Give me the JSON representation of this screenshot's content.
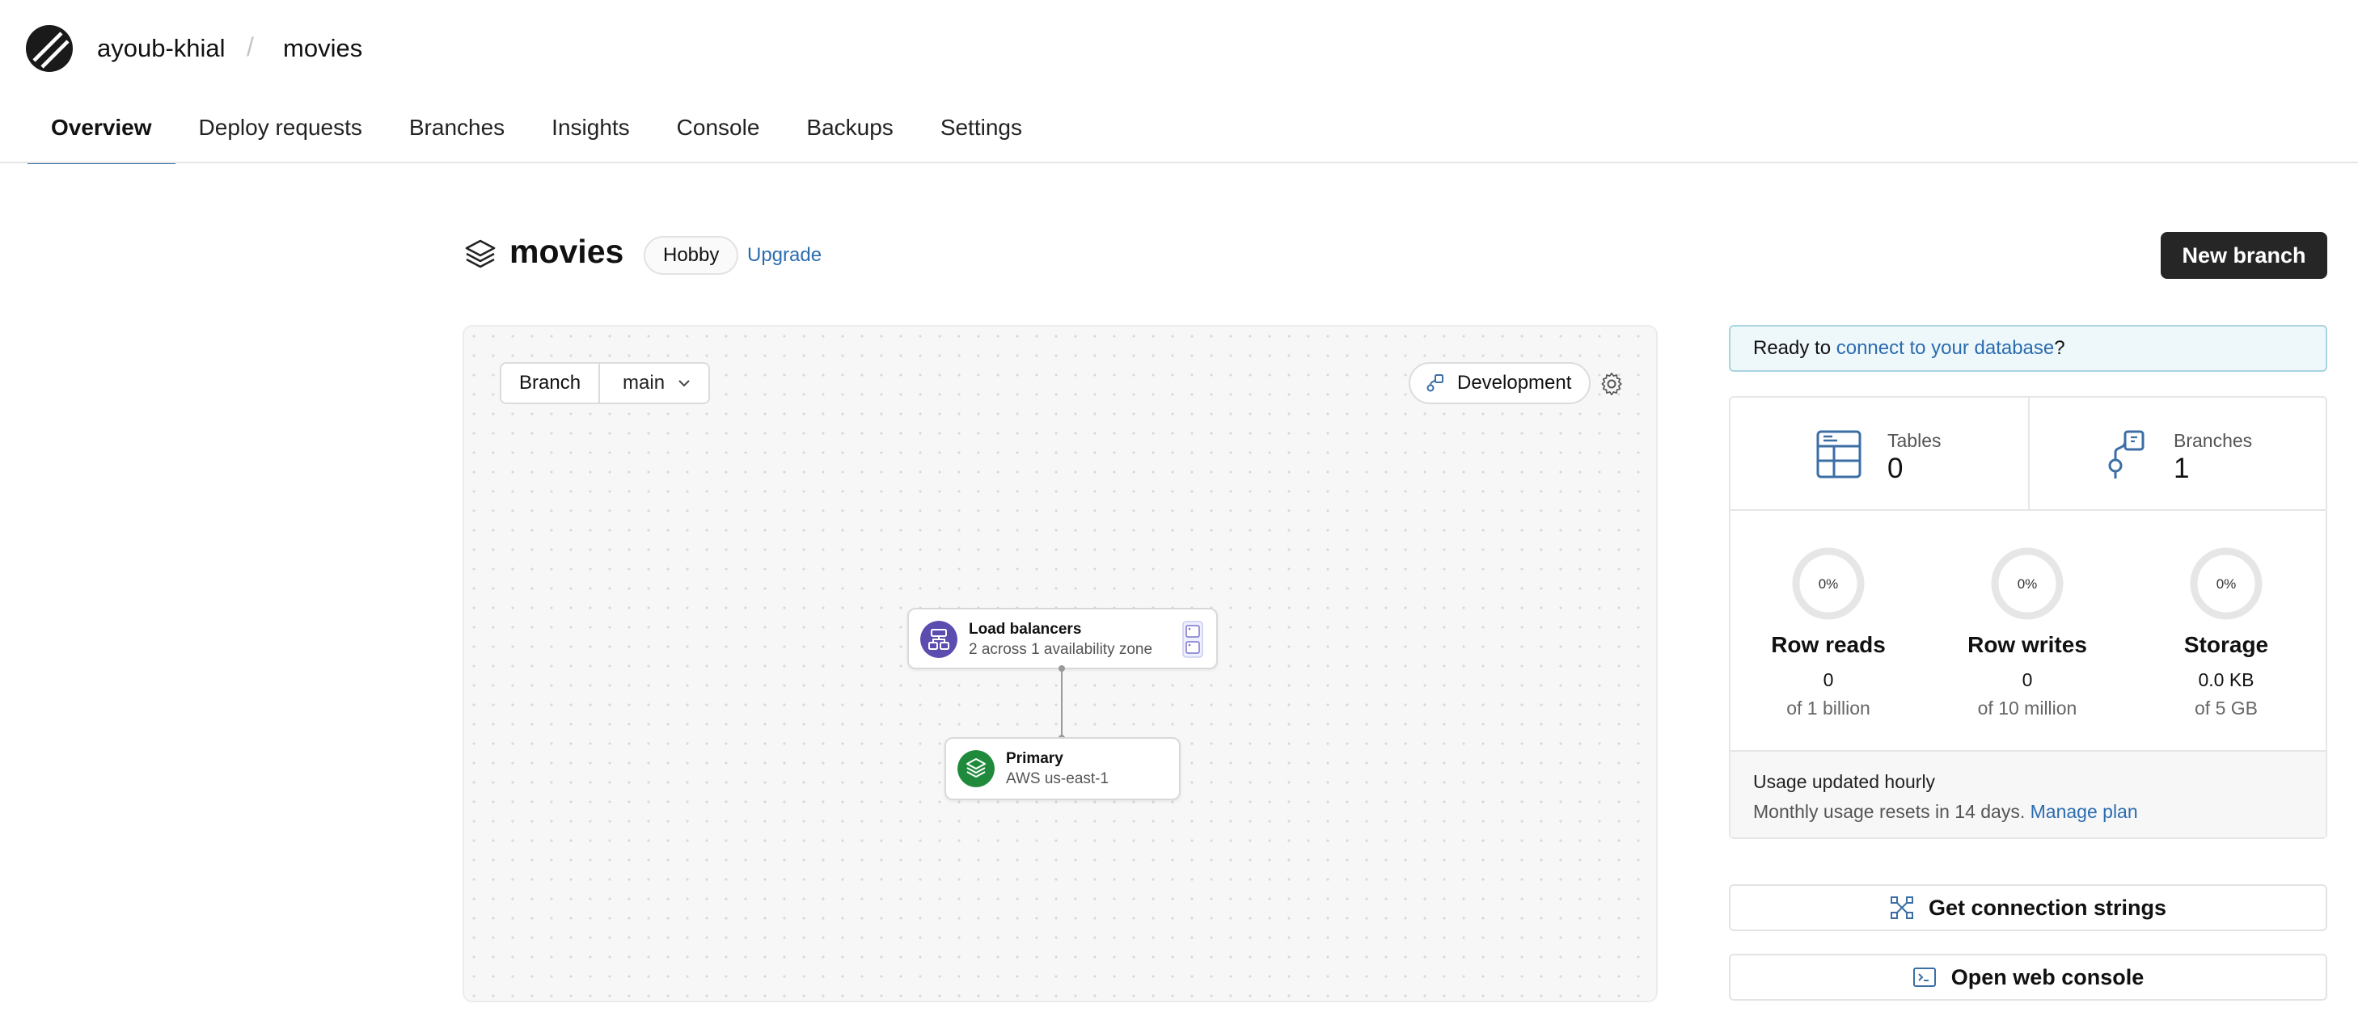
{
  "header": {
    "org": "ayoub-khial",
    "separator": "/",
    "database": "movies"
  },
  "tabs": [
    {
      "label": "Overview",
      "active": true
    },
    {
      "label": "Deploy requests"
    },
    {
      "label": "Branches"
    },
    {
      "label": "Insights"
    },
    {
      "label": "Console"
    },
    {
      "label": "Backups"
    },
    {
      "label": "Settings"
    }
  ],
  "page": {
    "title": "movies",
    "plan": "Hobby",
    "upgrade": "Upgrade",
    "new_branch": "New branch"
  },
  "canvas": {
    "branch_label": "Branch",
    "branch_value": "main",
    "environment": "Development",
    "load_balancer": {
      "title": "Load balancers",
      "subtitle": "2 across 1 availability zone"
    },
    "primary": {
      "title": "Primary",
      "subtitle": "AWS us-east-1"
    }
  },
  "ready": {
    "prefix": "Ready to ",
    "link": "connect to your database",
    "suffix": "?"
  },
  "stats": {
    "tables": {
      "label": "Tables",
      "value": "0"
    },
    "branches": {
      "label": "Branches",
      "value": "1"
    }
  },
  "usage": [
    {
      "percent": "0%",
      "title": "Row reads",
      "value": "0",
      "of": "of 1 billion"
    },
    {
      "percent": "0%",
      "title": "Row writes",
      "value": "0",
      "of": "of 10 million"
    },
    {
      "percent": "0%",
      "title": "Storage",
      "value": "0.0 KB",
      "of": "of 5 GB"
    }
  ],
  "usage_footer": {
    "line1": "Usage updated hourly",
    "line2": "Monthly usage resets in 14 days.",
    "link": "Manage plan"
  },
  "actions": {
    "connection": "Get connection strings",
    "console": "Open web console"
  },
  "colors": {
    "accent_link": "#2b6cb0",
    "lb_icon": "#5b4cb0",
    "primary_icon": "#1f8a3b",
    "button_dark": "#262626"
  }
}
